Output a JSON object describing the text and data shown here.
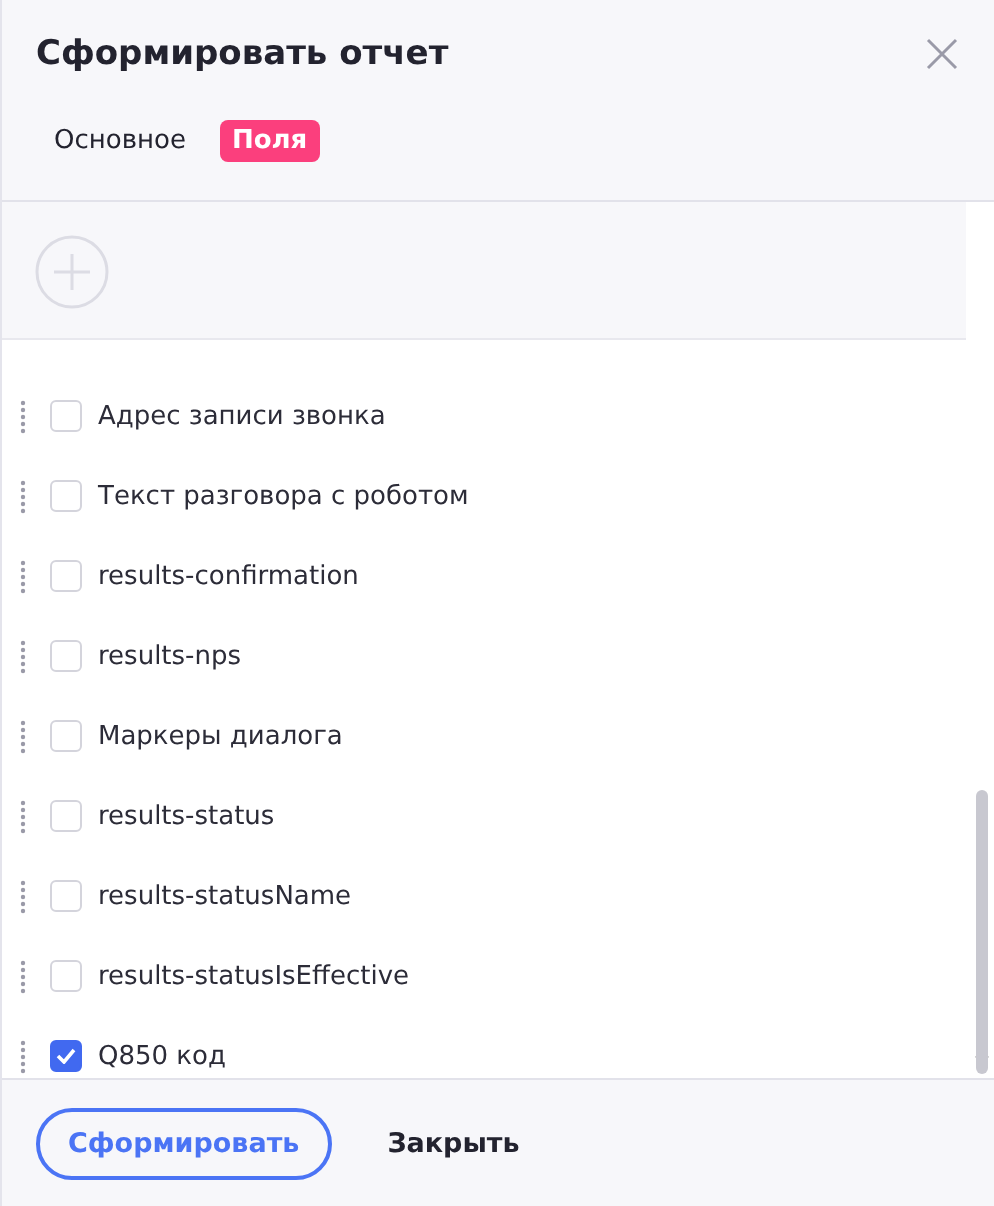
{
  "dialog": {
    "title": "Сформировать отчет"
  },
  "tabs": [
    {
      "label": "Основное",
      "selected": false
    },
    {
      "label": "Поля",
      "selected": true
    }
  ],
  "fields": [
    {
      "label": "Адрес записи звонка",
      "checked": false
    },
    {
      "label": "Текст разговора с роботом",
      "checked": false
    },
    {
      "label": "results-confirmation",
      "checked": false
    },
    {
      "label": "results-nps",
      "checked": false
    },
    {
      "label": "Маркеры диалога",
      "checked": false
    },
    {
      "label": "results-status",
      "checked": false
    },
    {
      "label": "results-statusName",
      "checked": false
    },
    {
      "label": "results-statusIsEffective",
      "checked": false
    },
    {
      "label": "Q850 код",
      "checked": true
    }
  ],
  "buttons": [
    {
      "label": "Сформировать",
      "kind": "primary"
    },
    {
      "label": "Закрыть",
      "kind": "plain"
    }
  ]
}
